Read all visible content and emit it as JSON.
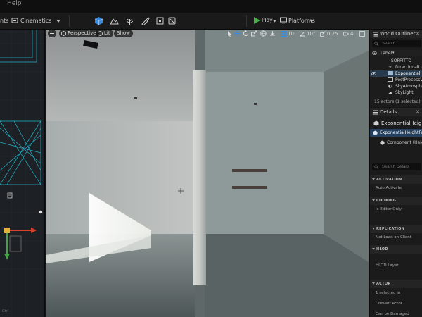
{
  "menubar": {
    "item": "Help"
  },
  "toolbar": {
    "left_partial": "nts",
    "cinematics_label": "Cinematics",
    "play_label": "Play",
    "platforms_label": "Platforms"
  },
  "viewport": {
    "perspective_label": "Perspective",
    "lit_label": "Lit",
    "show_label": "Show",
    "grid_snap": "10",
    "rotation_snap": "10°",
    "scale_snap": "0,25",
    "camera_speed": "4"
  },
  "outliner": {
    "title": "World Outliner",
    "search_placeholder": "Search...",
    "column_label": "Label",
    "items": [
      {
        "label": "SOFFITTO",
        "selected": false
      },
      {
        "label": "DirectionalLight",
        "selected": false
      },
      {
        "label": "ExponentialHeightFog",
        "selected": true
      },
      {
        "label": "PostProcessVolume",
        "selected": false
      },
      {
        "label": "SkyAtmosphere",
        "selected": false
      },
      {
        "label": "SkyLight",
        "selected": false
      }
    ],
    "count_text": "15 actors (1 selected)"
  },
  "details": {
    "title": "Details",
    "actor_name": "ExponentialHeightFog",
    "instance_label": "ExponentialHeightFog (Instance)",
    "component_label": "Component (HeightFogComponent)",
    "search_placeholder": "Search Details",
    "categories": [
      {
        "name": "ACTIVATION",
        "props": [
          "Auto Activate"
        ]
      },
      {
        "name": "COOKING",
        "props": [
          "Is Editor Only"
        ]
      },
      {
        "name": "REPLICATION",
        "props": [
          "Net Load on Client"
        ]
      },
      {
        "name": "HLOD",
        "props": [
          "HLOD Layer"
        ]
      },
      {
        "name": "ACTOR",
        "props": [
          "1 selected in",
          "Convert Actor",
          "Can be Damaged"
        ]
      }
    ]
  },
  "left_pane": {
    "footer": "Ctrl"
  },
  "colors": {
    "accent_blue": "#3a8be0",
    "play_green": "#49b04a",
    "selection": "#26394d",
    "panel_bg": "#1b1b1b"
  }
}
